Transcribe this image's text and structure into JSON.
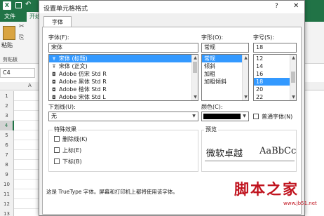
{
  "excel": {
    "logo": "X",
    "tabs": {
      "file": "文件",
      "home": "开始"
    },
    "ribbon": {
      "paste_label": "粘贴",
      "clipboard_label": "剪贴板",
      "cut_icon": "✂",
      "copy_icon": "⎘"
    },
    "name_box": "C4",
    "column_a": "A",
    "rows": [
      "1",
      "2",
      "3",
      "4",
      "5",
      "6",
      "7",
      "8",
      "9",
      "10",
      "11",
      "12",
      "13"
    ],
    "selected_row": "4"
  },
  "dialog": {
    "title": "设置单元格格式",
    "help": "?",
    "close": "✕",
    "tab": "字体",
    "font": {
      "label": "字体(F):",
      "value": "宋体",
      "items": [
        {
          "icon": "Ŧ",
          "name": "宋体 (标题)",
          "selected": true
        },
        {
          "icon": "Ŧ",
          "name": "宋体 (正文)",
          "selected": false
        },
        {
          "icon": "◘",
          "name": "Adobe 仿宋 Std R",
          "selected": false
        },
        {
          "icon": "◘",
          "name": "Adobe 黑体 Std R",
          "selected": false
        },
        {
          "icon": "◘",
          "name": "Adobe 楷体 Std R",
          "selected": false
        },
        {
          "icon": "◘",
          "name": "Adobe 宋体 Std L",
          "selected": false
        }
      ]
    },
    "style": {
      "label": "字形(O):",
      "value": "常规",
      "items": [
        {
          "name": "常规",
          "selected": true
        },
        {
          "name": "倾斜",
          "selected": false
        },
        {
          "name": "加粗",
          "selected": false
        },
        {
          "name": "加粗倾斜",
          "selected": false
        }
      ]
    },
    "size": {
      "label": "字号(S):",
      "value": "18",
      "items": [
        {
          "name": "12",
          "selected": false
        },
        {
          "name": "14",
          "selected": false
        },
        {
          "name": "16",
          "selected": false
        },
        {
          "name": "18",
          "selected": true
        },
        {
          "name": "20",
          "selected": false
        },
        {
          "name": "22",
          "selected": false
        }
      ]
    },
    "underline": {
      "label": "下划线(U):",
      "value": "无"
    },
    "color": {
      "label": "颜色(C):",
      "swatch": "#000000"
    },
    "normal_font": {
      "label": "普通字体(N)",
      "checked": false
    },
    "effects": {
      "title": "特殊效果",
      "items": [
        {
          "label": "删除线(K)",
          "checked": false
        },
        {
          "label": "上标(E)",
          "checked": false
        },
        {
          "label": "下标(B)",
          "checked": false
        }
      ]
    },
    "preview": {
      "title": "预览",
      "cjk": "微软卓越",
      "latin": "AaBbCc"
    },
    "footnote": "这是 TrueType 字体。屏幕和打印机上都将使用该字体。"
  },
  "watermark": {
    "text": "脚本之家",
    "url": "www.jb51.net"
  }
}
